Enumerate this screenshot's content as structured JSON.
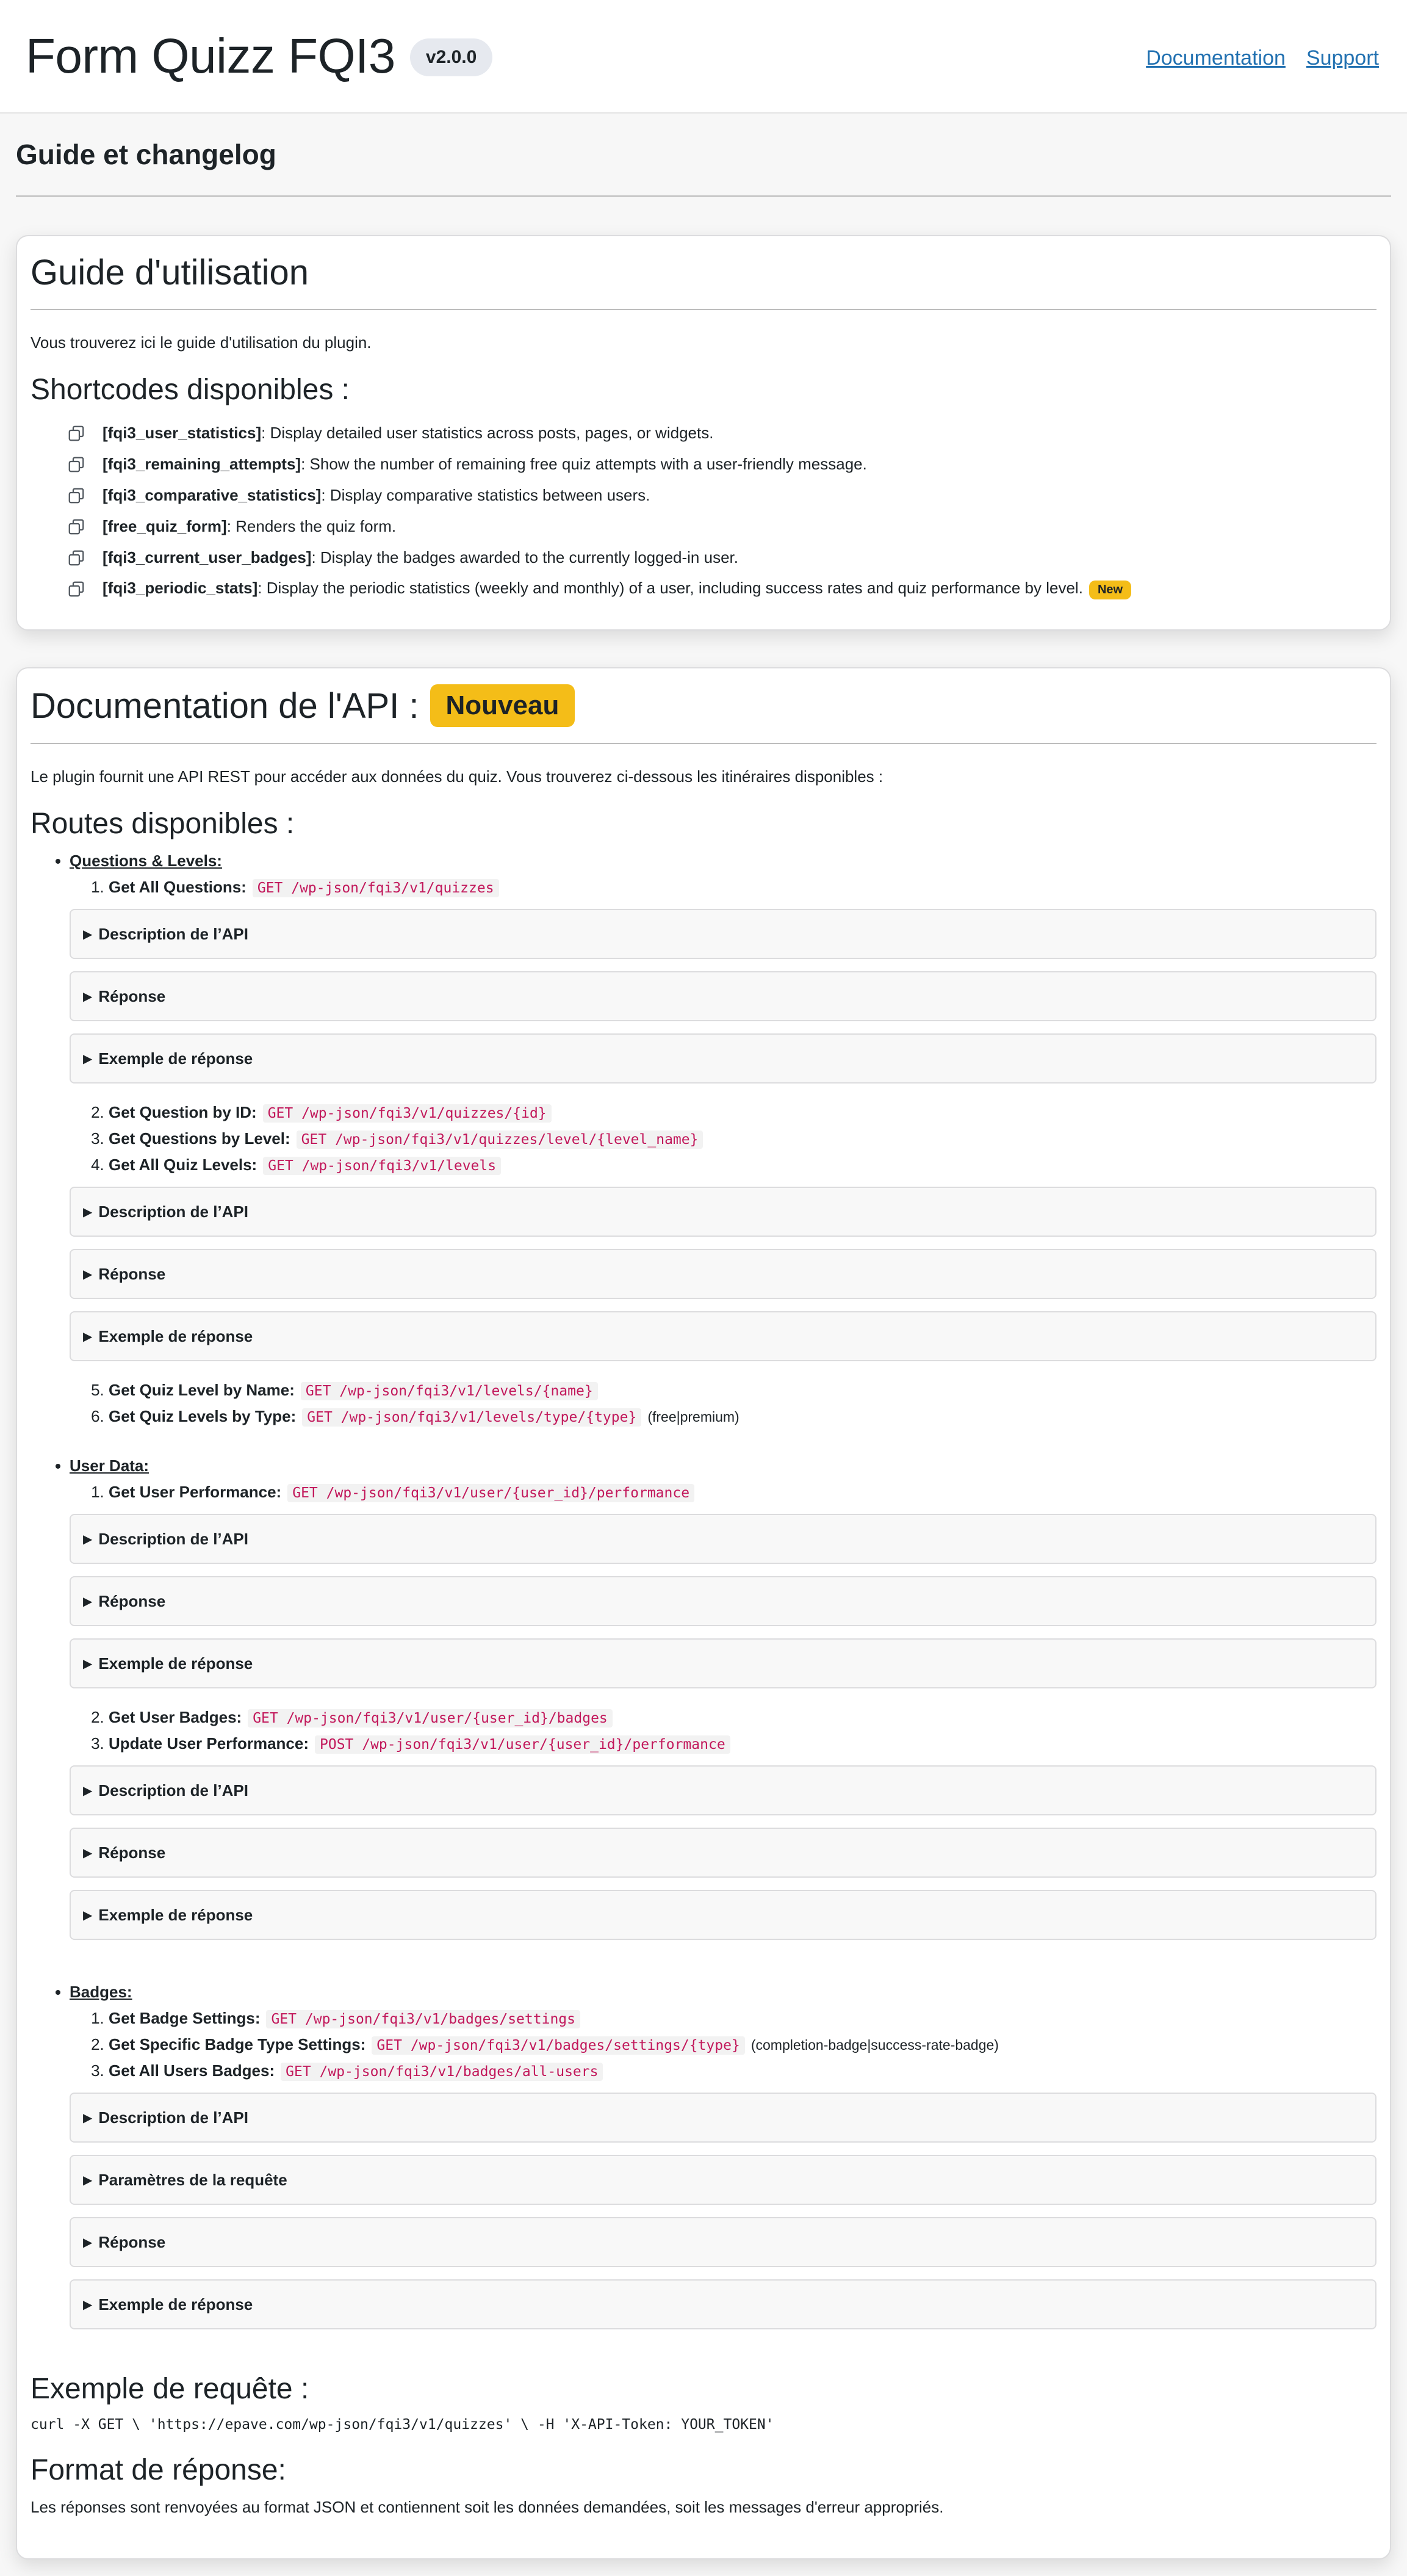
{
  "header": {
    "title": "Form Quizz FQI3",
    "version": "v2.0.0",
    "links": [
      "Documentation",
      "Support"
    ]
  },
  "page": {
    "title": "Guide et changelog"
  },
  "guide": {
    "title": "Guide d'utilisation",
    "intro": "Vous trouverez ici le guide d'utilisation du plugin.",
    "shortcodes_title": "Shortcodes disponibles :",
    "shortcodes": [
      {
        "code": "[fqi3_user_statistics]",
        "desc": ": Display detailed user statistics across posts, pages, or widgets."
      },
      {
        "code": "[fqi3_remaining_attempts]",
        "desc": ": Show the number of remaining free quiz attempts with a user-friendly message."
      },
      {
        "code": "[fqi3_comparative_statistics]",
        "desc": ": Display comparative statistics between users."
      },
      {
        "code": "[free_quiz_form]",
        "desc": ": Renders the quiz form."
      },
      {
        "code": "[fqi3_current_user_badges]",
        "desc": ": Display the badges awarded to the currently logged-in user."
      },
      {
        "code": "[fqi3_periodic_stats]",
        "desc": ": Display the periodic statistics (weekly and monthly) of a user, including success rates and quiz performance by level.",
        "badge": "New"
      }
    ]
  },
  "api": {
    "title": "Documentation de l'API :",
    "badge": "Nouveau",
    "intro": "Le plugin fournit une API REST pour accéder aux données du quiz. Vous trouverez ci-dessous les itinéraires disponibles :",
    "routes_title": "Routes disponibles :",
    "details": {
      "desc": "Description de l’API",
      "response": "Réponse",
      "example": "Exemple de réponse",
      "params": "Paramètres de la requête"
    },
    "groups": [
      {
        "title": "Questions & Levels:",
        "routes": [
          {
            "label": "Get All Questions:",
            "endpoint": "GET /wp-json/fqi3/v1/quizzes"
          },
          {
            "label": "Get Question by ID:",
            "endpoint": "GET /wp-json/fqi3/v1/quizzes/{id}"
          },
          {
            "label": "Get Questions by Level:",
            "endpoint": "GET /wp-json/fqi3/v1/quizzes/level/{level_name}"
          },
          {
            "label": "Get All Quiz Levels:",
            "endpoint": "GET /wp-json/fqi3/v1/levels"
          },
          {
            "label": "Get Quiz Level by Name:",
            "endpoint": "GET /wp-json/fqi3/v1/levels/{name}"
          },
          {
            "label": "Get Quiz Levels by Type:",
            "endpoint": "GET /wp-json/fqi3/v1/levels/type/{type}",
            "note": "(free|premium)"
          }
        ]
      },
      {
        "title": "User Data:",
        "routes": [
          {
            "label": "Get User Performance:",
            "endpoint": "GET /wp-json/fqi3/v1/user/{user_id}/performance"
          },
          {
            "label": "Get User Badges:",
            "endpoint": "GET /wp-json/fqi3/v1/user/{user_id}/badges"
          },
          {
            "label": "Update User Performance:",
            "endpoint": "POST /wp-json/fqi3/v1/user/{user_id}/performance"
          }
        ]
      },
      {
        "title": "Badges:",
        "routes": [
          {
            "label": "Get Badge Settings:",
            "endpoint": "GET /wp-json/fqi3/v1/badges/settings"
          },
          {
            "label": "Get Specific Badge Type Settings:",
            "endpoint": "GET /wp-json/fqi3/v1/badges/settings/{type}",
            "note": "(completion-badge|success-rate-badge)"
          },
          {
            "label": "Get All Users Badges:",
            "endpoint": "GET /wp-json/fqi3/v1/badges/all-users"
          }
        ]
      }
    ],
    "example_title": "Exemple de requête :",
    "example_cmd": "curl -X GET \\ 'https://epave.com/wp-json/fqi3/v1/quizzes' \\ -H 'X-API-Token: YOUR_TOKEN'",
    "format_title": "Format de réponse:",
    "format_text": "Les réponses sont renvoyées au format JSON et contiennent soit les données demandées, soit les messages d'erreur appropriés."
  },
  "colors": {
    "accent": "#2271b1",
    "badge": "#f4bd18",
    "code": "#c2185b"
  },
  "icons": {
    "shortcode": "copy-icon",
    "details": "disclosure-triangle-icon"
  }
}
